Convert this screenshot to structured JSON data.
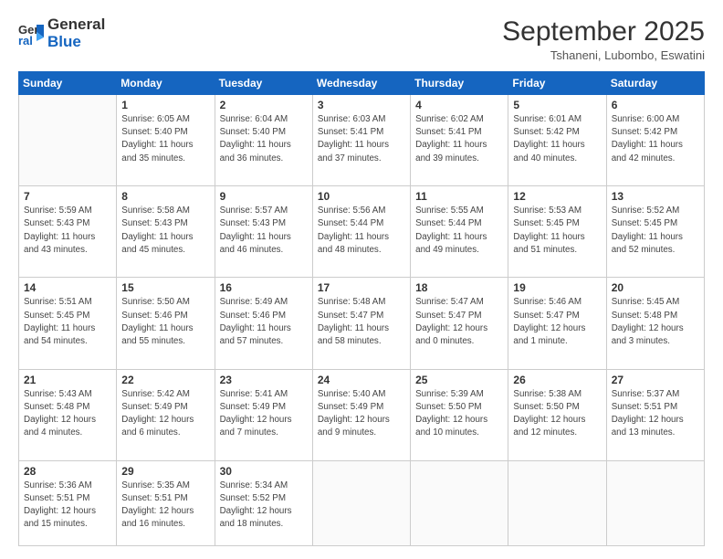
{
  "header": {
    "logo_line1": "General",
    "logo_line2": "Blue",
    "month_title": "September 2025",
    "subtitle": "Tshaneni, Lubombo, Eswatini"
  },
  "days_of_week": [
    "Sunday",
    "Monday",
    "Tuesday",
    "Wednesday",
    "Thursday",
    "Friday",
    "Saturday"
  ],
  "weeks": [
    [
      {
        "day": "",
        "info": ""
      },
      {
        "day": "1",
        "info": "Sunrise: 6:05 AM\nSunset: 5:40 PM\nDaylight: 11 hours\nand 35 minutes."
      },
      {
        "day": "2",
        "info": "Sunrise: 6:04 AM\nSunset: 5:40 PM\nDaylight: 11 hours\nand 36 minutes."
      },
      {
        "day": "3",
        "info": "Sunrise: 6:03 AM\nSunset: 5:41 PM\nDaylight: 11 hours\nand 37 minutes."
      },
      {
        "day": "4",
        "info": "Sunrise: 6:02 AM\nSunset: 5:41 PM\nDaylight: 11 hours\nand 39 minutes."
      },
      {
        "day": "5",
        "info": "Sunrise: 6:01 AM\nSunset: 5:42 PM\nDaylight: 11 hours\nand 40 minutes."
      },
      {
        "day": "6",
        "info": "Sunrise: 6:00 AM\nSunset: 5:42 PM\nDaylight: 11 hours\nand 42 minutes."
      }
    ],
    [
      {
        "day": "7",
        "info": "Sunrise: 5:59 AM\nSunset: 5:43 PM\nDaylight: 11 hours\nand 43 minutes."
      },
      {
        "day": "8",
        "info": "Sunrise: 5:58 AM\nSunset: 5:43 PM\nDaylight: 11 hours\nand 45 minutes."
      },
      {
        "day": "9",
        "info": "Sunrise: 5:57 AM\nSunset: 5:43 PM\nDaylight: 11 hours\nand 46 minutes."
      },
      {
        "day": "10",
        "info": "Sunrise: 5:56 AM\nSunset: 5:44 PM\nDaylight: 11 hours\nand 48 minutes."
      },
      {
        "day": "11",
        "info": "Sunrise: 5:55 AM\nSunset: 5:44 PM\nDaylight: 11 hours\nand 49 minutes."
      },
      {
        "day": "12",
        "info": "Sunrise: 5:53 AM\nSunset: 5:45 PM\nDaylight: 11 hours\nand 51 minutes."
      },
      {
        "day": "13",
        "info": "Sunrise: 5:52 AM\nSunset: 5:45 PM\nDaylight: 11 hours\nand 52 minutes."
      }
    ],
    [
      {
        "day": "14",
        "info": "Sunrise: 5:51 AM\nSunset: 5:45 PM\nDaylight: 11 hours\nand 54 minutes."
      },
      {
        "day": "15",
        "info": "Sunrise: 5:50 AM\nSunset: 5:46 PM\nDaylight: 11 hours\nand 55 minutes."
      },
      {
        "day": "16",
        "info": "Sunrise: 5:49 AM\nSunset: 5:46 PM\nDaylight: 11 hours\nand 57 minutes."
      },
      {
        "day": "17",
        "info": "Sunrise: 5:48 AM\nSunset: 5:47 PM\nDaylight: 11 hours\nand 58 minutes."
      },
      {
        "day": "18",
        "info": "Sunrise: 5:47 AM\nSunset: 5:47 PM\nDaylight: 12 hours\nand 0 minutes."
      },
      {
        "day": "19",
        "info": "Sunrise: 5:46 AM\nSunset: 5:47 PM\nDaylight: 12 hours\nand 1 minute."
      },
      {
        "day": "20",
        "info": "Sunrise: 5:45 AM\nSunset: 5:48 PM\nDaylight: 12 hours\nand 3 minutes."
      }
    ],
    [
      {
        "day": "21",
        "info": "Sunrise: 5:43 AM\nSunset: 5:48 PM\nDaylight: 12 hours\nand 4 minutes."
      },
      {
        "day": "22",
        "info": "Sunrise: 5:42 AM\nSunset: 5:49 PM\nDaylight: 12 hours\nand 6 minutes."
      },
      {
        "day": "23",
        "info": "Sunrise: 5:41 AM\nSunset: 5:49 PM\nDaylight: 12 hours\nand 7 minutes."
      },
      {
        "day": "24",
        "info": "Sunrise: 5:40 AM\nSunset: 5:49 PM\nDaylight: 12 hours\nand 9 minutes."
      },
      {
        "day": "25",
        "info": "Sunrise: 5:39 AM\nSunset: 5:50 PM\nDaylight: 12 hours\nand 10 minutes."
      },
      {
        "day": "26",
        "info": "Sunrise: 5:38 AM\nSunset: 5:50 PM\nDaylight: 12 hours\nand 12 minutes."
      },
      {
        "day": "27",
        "info": "Sunrise: 5:37 AM\nSunset: 5:51 PM\nDaylight: 12 hours\nand 13 minutes."
      }
    ],
    [
      {
        "day": "28",
        "info": "Sunrise: 5:36 AM\nSunset: 5:51 PM\nDaylight: 12 hours\nand 15 minutes."
      },
      {
        "day": "29",
        "info": "Sunrise: 5:35 AM\nSunset: 5:51 PM\nDaylight: 12 hours\nand 16 minutes."
      },
      {
        "day": "30",
        "info": "Sunrise: 5:34 AM\nSunset: 5:52 PM\nDaylight: 12 hours\nand 18 minutes."
      },
      {
        "day": "",
        "info": ""
      },
      {
        "day": "",
        "info": ""
      },
      {
        "day": "",
        "info": ""
      },
      {
        "day": "",
        "info": ""
      }
    ]
  ]
}
